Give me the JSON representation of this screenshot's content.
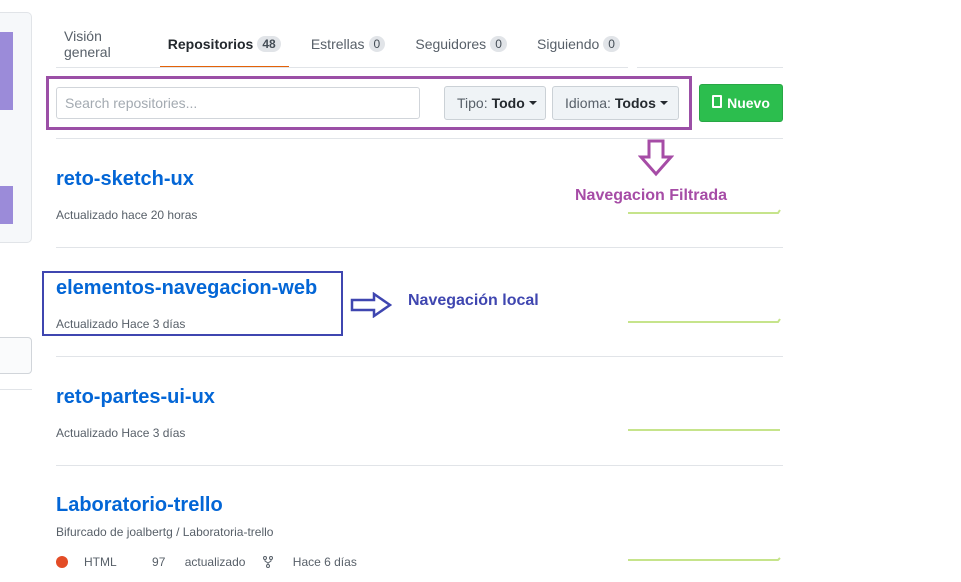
{
  "tabs": [
    {
      "label": "Visión general",
      "count": null
    },
    {
      "label": "Repositorios",
      "count": "48"
    },
    {
      "label": "Estrellas",
      "count": "0"
    },
    {
      "label": "Seguidores",
      "count": "0"
    },
    {
      "label": "Siguiendo",
      "count": "0"
    }
  ],
  "filter": {
    "search_placeholder": "Search repositories...",
    "tipo_label": "Tipo:",
    "tipo_value": "Todo",
    "idioma_label": "Idioma:",
    "idioma_value": "Todos",
    "new_label": "Nuevo"
  },
  "annotations": {
    "filtrada": "Navegacion Filtrada",
    "local": "Navegación local"
  },
  "repos": [
    {
      "name": "reto-sketch-ux",
      "updated": "Actualizado hace 20 horas"
    },
    {
      "name": "elementos-navegacion-web",
      "updated": "Actualizado Hace 3 días"
    },
    {
      "name": "reto-partes-ui-ux",
      "updated": "Actualizado Hace 3 días"
    },
    {
      "name": "Laboratorio-trello",
      "forked_from": "Bifurcado de joalbertg / Laboratoria-trello",
      "language": "HTML",
      "stars": "97",
      "forks_label": "actualizado",
      "updated": "Hace 6 días"
    }
  ],
  "colors": {
    "link": "#0366d6",
    "accent_tab": "#e36209",
    "new_button": "#2cbe4e",
    "annotation_purple": "#a64ca6",
    "annotation_blue": "#3f46b0",
    "html_lang": "#e34c26"
  },
  "icons": [
    "book-icon",
    "caret-down-icon",
    "fork-icon",
    "down-arrow-icon",
    "right-arrow-icon"
  ]
}
